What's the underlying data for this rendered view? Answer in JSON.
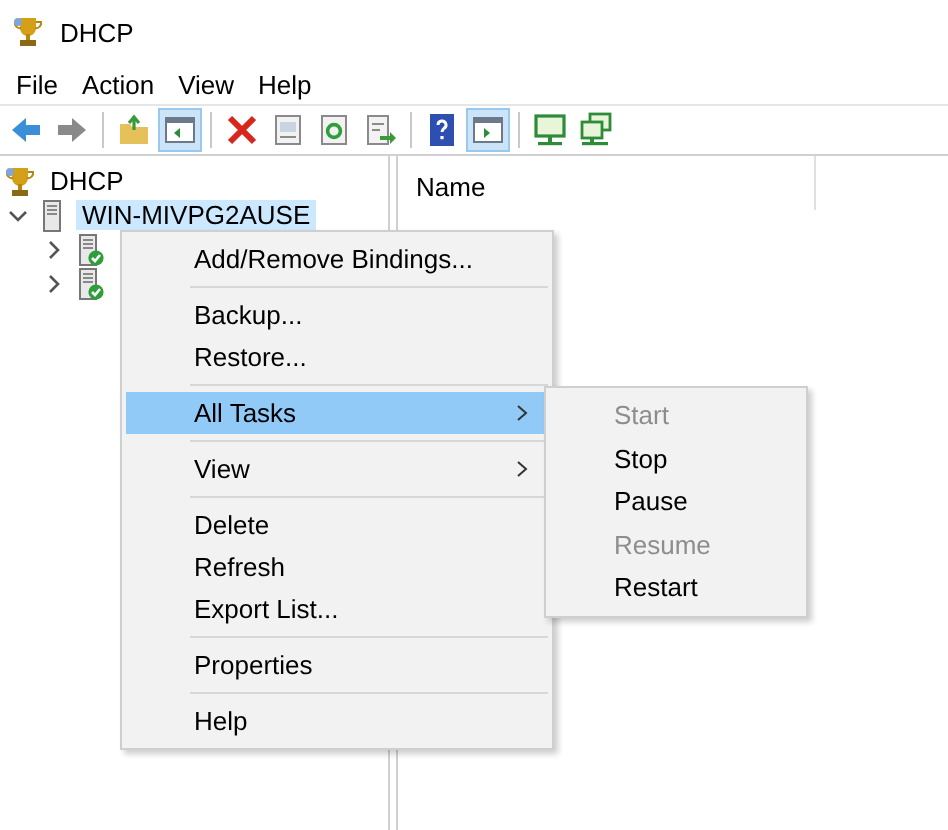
{
  "window": {
    "title": "DHCP"
  },
  "menu_bar": [
    "File",
    "Action",
    "View",
    "Help"
  ],
  "toolbar": [
    {
      "kind": "back",
      "pressed": false
    },
    {
      "kind": "forward",
      "pressed": false
    },
    {
      "kind": "separator"
    },
    {
      "kind": "up",
      "pressed": false
    },
    {
      "kind": "tree-pane",
      "pressed": true
    },
    {
      "kind": "separator"
    },
    {
      "kind": "delete",
      "pressed": false
    },
    {
      "kind": "properties",
      "pressed": false
    },
    {
      "kind": "refresh",
      "pressed": false
    },
    {
      "kind": "export",
      "pressed": false
    },
    {
      "kind": "separator"
    },
    {
      "kind": "help",
      "pressed": false
    },
    {
      "kind": "action-pane",
      "pressed": true
    },
    {
      "kind": "separator"
    },
    {
      "kind": "computer",
      "pressed": false
    },
    {
      "kind": "computers",
      "pressed": false
    }
  ],
  "tree": [
    {
      "label": "DHCP",
      "kind": "root",
      "selected": false,
      "children": [
        {
          "label": "WIN-MIVPG2AUSE",
          "kind": "server",
          "expanded": true,
          "selected": true,
          "children": [
            {
              "kind": "scope",
              "expanded": false
            },
            {
              "kind": "scope",
              "expanded": false
            }
          ]
        }
      ]
    }
  ],
  "list": {
    "columns": [
      "Name"
    ]
  },
  "context_menu": [
    {
      "kind": "item",
      "label": "Add/Remove Bindings...",
      "selected": false,
      "submenu": false
    },
    {
      "kind": "separator"
    },
    {
      "kind": "item",
      "label": "Backup...",
      "selected": false,
      "submenu": false
    },
    {
      "kind": "item",
      "label": "Restore...",
      "selected": false,
      "submenu": false
    },
    {
      "kind": "separator"
    },
    {
      "kind": "item",
      "label": "All Tasks",
      "selected": true,
      "submenu": true
    },
    {
      "kind": "separator"
    },
    {
      "kind": "item",
      "label": "View",
      "selected": false,
      "submenu": true
    },
    {
      "kind": "separator"
    },
    {
      "kind": "item",
      "label": "Delete",
      "selected": false,
      "submenu": false
    },
    {
      "kind": "item",
      "label": "Refresh",
      "selected": false,
      "submenu": false
    },
    {
      "kind": "item",
      "label": "Export List...",
      "selected": false,
      "submenu": false
    },
    {
      "kind": "separator"
    },
    {
      "kind": "item",
      "label": "Properties",
      "selected": false,
      "submenu": false
    },
    {
      "kind": "separator"
    },
    {
      "kind": "item",
      "label": "Help",
      "selected": false,
      "submenu": false
    }
  ],
  "submenu": [
    {
      "label": "Start",
      "disabled": true
    },
    {
      "label": "Stop",
      "disabled": false
    },
    {
      "label": "Pause",
      "disabled": false
    },
    {
      "label": "Resume",
      "disabled": true
    },
    {
      "label": "Restart",
      "disabled": false
    }
  ]
}
